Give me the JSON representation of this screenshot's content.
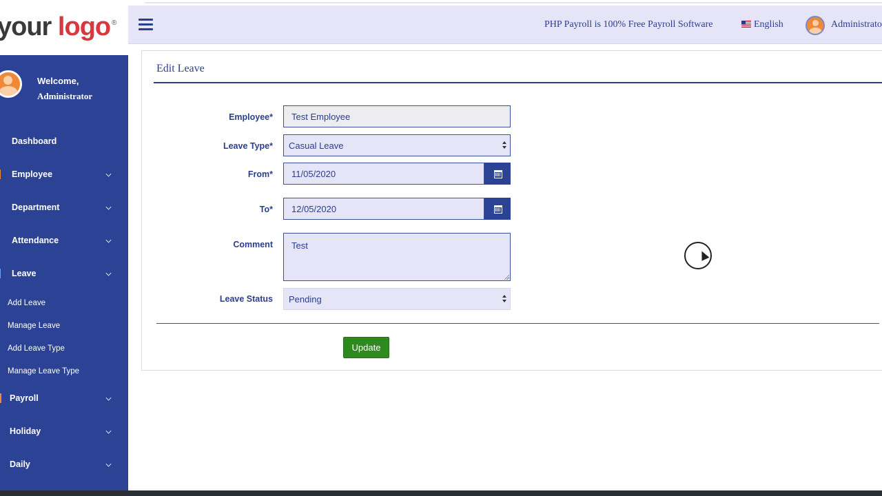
{
  "brand": {
    "logo_your": "your",
    "logo_logo": "logo",
    "logo_reg": "®"
  },
  "header": {
    "tagline": "PHP Payroll is 100% Free Payroll Software",
    "language": "English",
    "user": "Administrator"
  },
  "sidebar": {
    "welcome": "Welcome,",
    "user_name": "Administrator",
    "items": [
      {
        "label": "Dashboard"
      },
      {
        "label": "Employee"
      },
      {
        "label": "Department"
      },
      {
        "label": "Attendance"
      },
      {
        "label": "Leave"
      },
      {
        "label": "Payroll"
      },
      {
        "label": "Holiday"
      },
      {
        "label": "Daily"
      }
    ],
    "leave_sub_items": [
      {
        "label": "Add Leave"
      },
      {
        "label": "Manage Leave"
      },
      {
        "label": "Add Leave Type"
      },
      {
        "label": "Manage Leave Type"
      }
    ]
  },
  "form": {
    "title": "Edit Leave",
    "employee": {
      "label": "Employee*",
      "value": "Test Employee"
    },
    "leave_type": {
      "label": "Leave Type*",
      "value": "Casual Leave"
    },
    "from": {
      "label": "From*",
      "value": "11/05/2020"
    },
    "to": {
      "label": "To*",
      "value": "12/05/2020"
    },
    "comment": {
      "label": "Comment",
      "value": "Test"
    },
    "leave_status": {
      "label": "Leave Status",
      "value": "Pending"
    },
    "submit_label": "Update"
  },
  "colors": {
    "sidebar_bg": "#2c4395",
    "header_bg": "#e5e5f7",
    "text_primary": "#2b3e8e",
    "button_green": "#2f8a1d",
    "logo_red": "#d9363e"
  },
  "icons": [
    "hamburger-icon",
    "flag-icon",
    "avatar-icon",
    "calendar-icon",
    "chevron-down-icon"
  ]
}
